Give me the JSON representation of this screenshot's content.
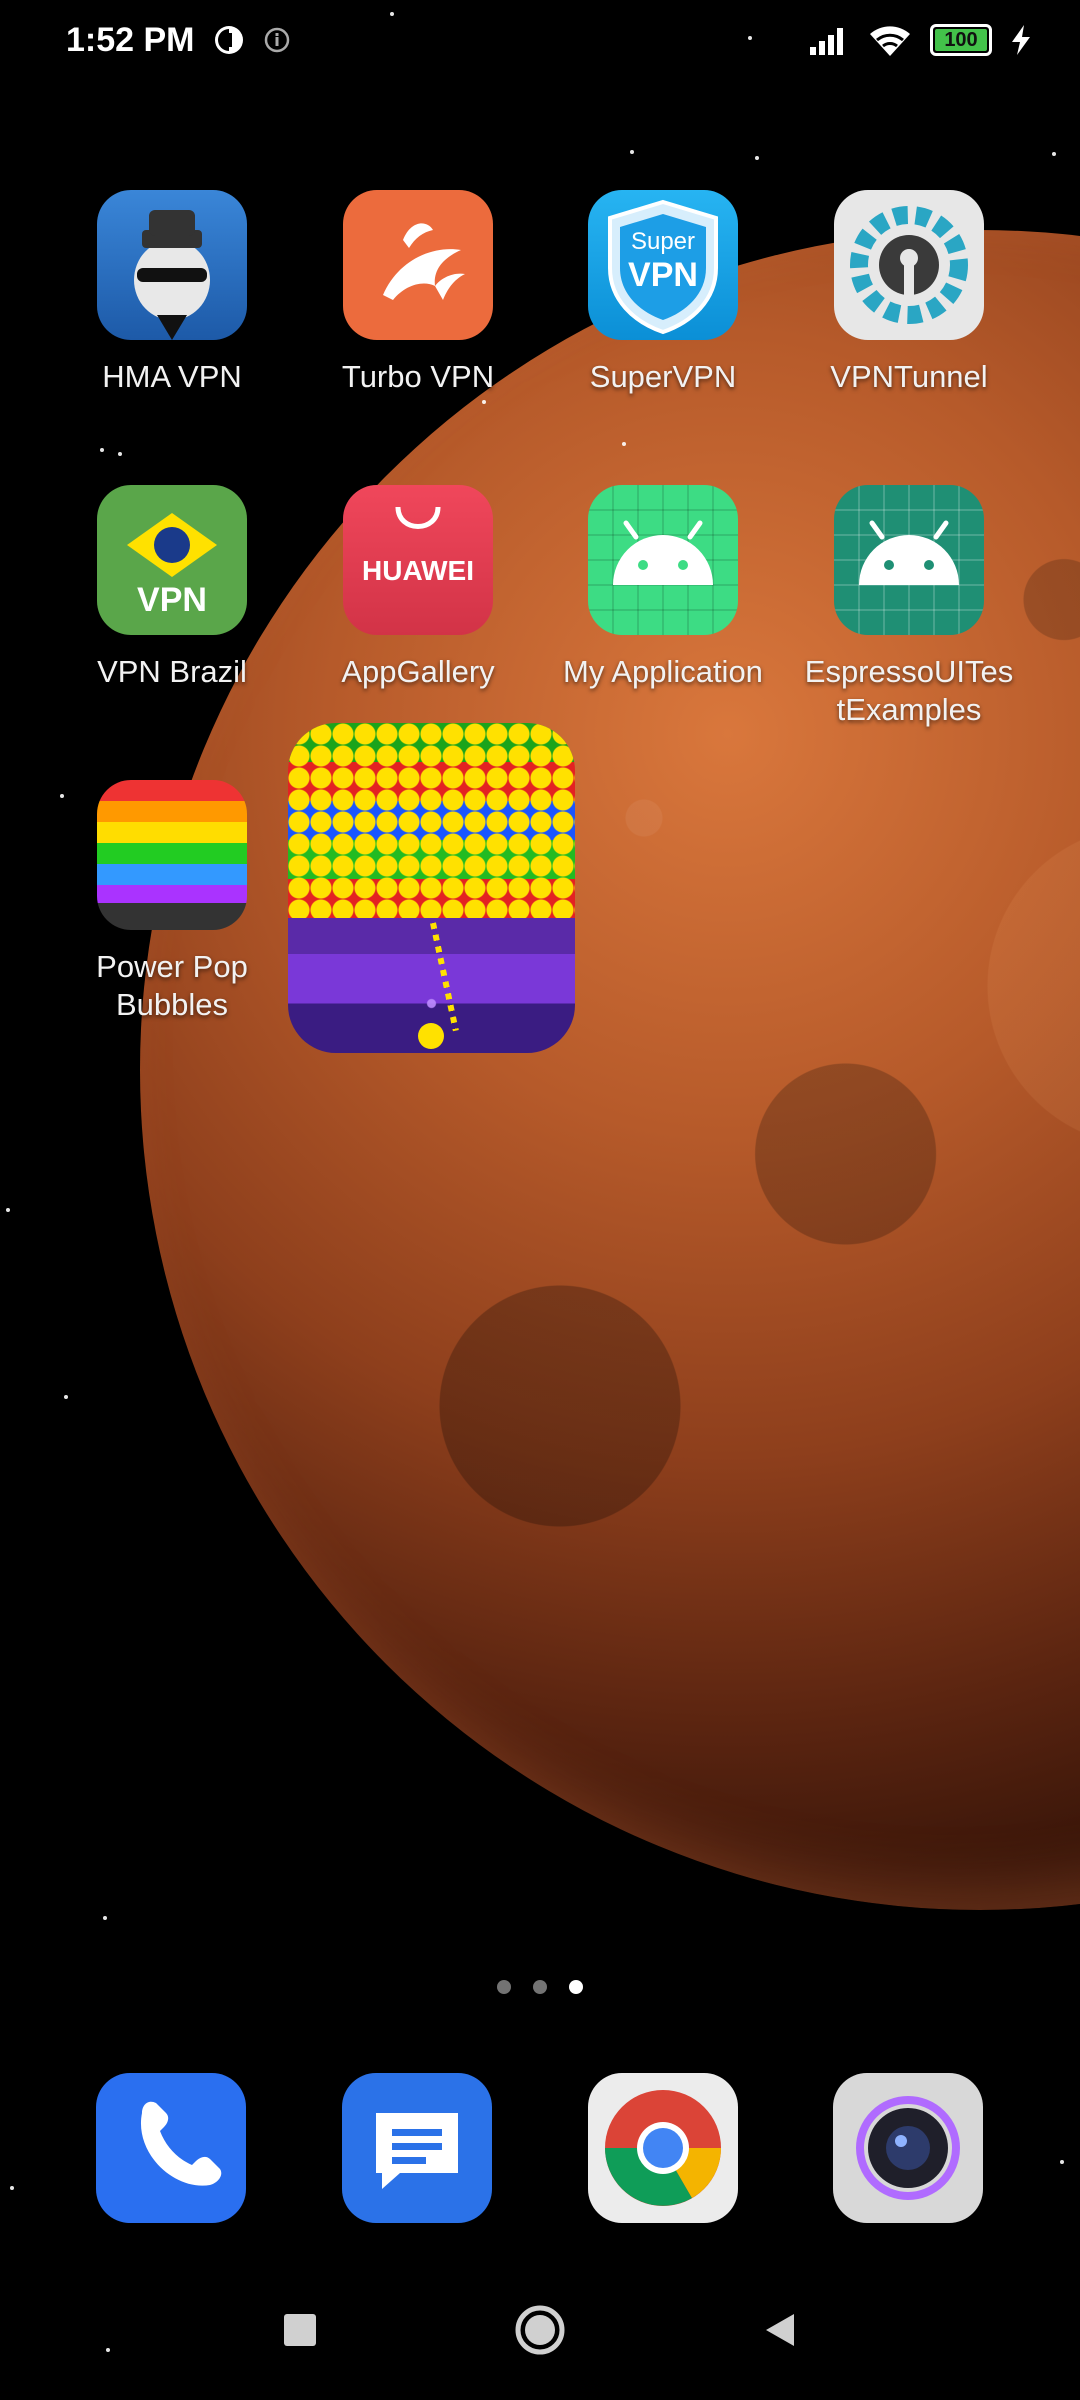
{
  "status_bar": {
    "time": "1:52 PM",
    "battery_level": "100",
    "icons": [
      "data-saver-icon",
      "info-icon",
      "signal-icon",
      "wifi-icon",
      "battery-icon",
      "charging-icon"
    ]
  },
  "home": {
    "apps": [
      {
        "label": "HMA VPN",
        "icon": "hma-vpn-icon"
      },
      {
        "label": "Turbo VPN",
        "icon": "turbo-vpn-icon"
      },
      {
        "label": "SuperVPN",
        "icon": "supervpn-icon",
        "icon_text_top": "Super",
        "icon_text_bottom": "VPN"
      },
      {
        "label": "VPNTunnel",
        "icon": "vpntunnel-icon"
      },
      {
        "label": "VPN Brazil",
        "icon": "vpn-brazil-icon",
        "icon_text": "VPN"
      },
      {
        "label": "AppGallery",
        "icon": "appgallery-icon",
        "icon_text": "HUAWEI"
      },
      {
        "label": "My Application",
        "icon": "android-icon"
      },
      {
        "label": "EspressoUITes\ntExamples",
        "icon": "android-icon"
      },
      {
        "label": "Power Pop\nBubbles",
        "icon": "power-pop-bubbles-icon"
      }
    ],
    "widget": {
      "name": "bubble-shooter-widget"
    }
  },
  "pager": {
    "pages": 3,
    "active_page": 3
  },
  "dock": {
    "apps": [
      {
        "name": "phone-icon"
      },
      {
        "name": "messages-icon"
      },
      {
        "name": "chrome-icon"
      },
      {
        "name": "camera-icon"
      }
    ]
  },
  "navigation": {
    "buttons": [
      "recents-button",
      "home-button",
      "back-button"
    ]
  }
}
